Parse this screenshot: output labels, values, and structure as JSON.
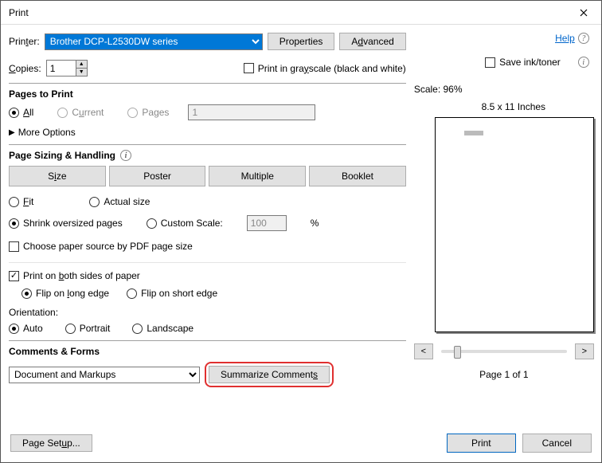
{
  "window": {
    "title": "Print"
  },
  "top": {
    "printer_label": "Printer:",
    "printer_value": "Brother DCP-L2530DW series",
    "properties": "Properties",
    "advanced": "Advanced",
    "help": "Help"
  },
  "copies": {
    "label": "Copies:",
    "value": "1",
    "grayscale": "Print in grayscale (black and white)",
    "save_ink": "Save ink/toner"
  },
  "pages": {
    "title": "Pages to Print",
    "all": "All",
    "current": "Current",
    "pages": "Pages",
    "pages_value": "1",
    "more": "More Options"
  },
  "sizing": {
    "title": "Page Sizing & Handling",
    "size": "Size",
    "poster": "Poster",
    "multiple": "Multiple",
    "booklet": "Booklet",
    "fit": "Fit",
    "actual": "Actual size",
    "shrink": "Shrink oversized pages",
    "custom": "Custom Scale:",
    "custom_value": "100",
    "pct": "%",
    "choose_source": "Choose paper source by PDF page size"
  },
  "duplex": {
    "both": "Print on both sides of paper",
    "long": "Flip on long edge",
    "short": "Flip on short edge"
  },
  "orientation": {
    "label": "Orientation:",
    "auto": "Auto",
    "portrait": "Portrait",
    "landscape": "Landscape"
  },
  "cf": {
    "title": "Comments & Forms",
    "selected": "Document and Markups",
    "summarize": "Summarize Comments"
  },
  "preview": {
    "scale": "Scale:  96%",
    "paper": "8.5 x 11 Inches",
    "prev": "<",
    "next": ">",
    "page_of": "Page 1 of 1"
  },
  "footer": {
    "page_setup": "Page Setup...",
    "print": "Print",
    "cancel": "Cancel"
  }
}
